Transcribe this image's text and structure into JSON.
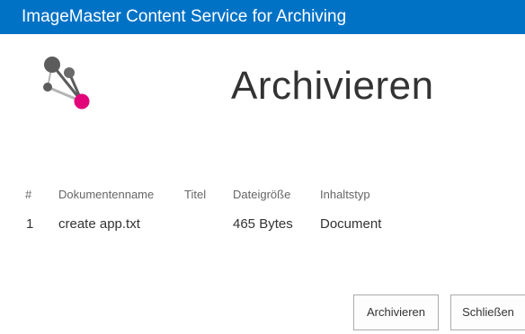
{
  "window": {
    "title": "ImageMaster Content Service for Archiving"
  },
  "logo": {
    "icon": "network-nodes-icon",
    "colors": {
      "gray": "#5c5c5c",
      "light_gray": "#b5b5b5",
      "accent": "#e2057a"
    }
  },
  "page": {
    "heading": "Archivieren"
  },
  "table": {
    "columns": [
      "#",
      "Dokumentenname",
      "Titel",
      "Dateigröße",
      "Inhaltstyp"
    ],
    "rows": [
      {
        "index": "1",
        "name": "create app.txt",
        "title": "",
        "size": "465 Bytes",
        "type": "Document"
      }
    ]
  },
  "buttons": {
    "archive_label": "Archivieren",
    "close_label": "Schließen"
  },
  "colors": {
    "titlebar": "#0072c6"
  }
}
